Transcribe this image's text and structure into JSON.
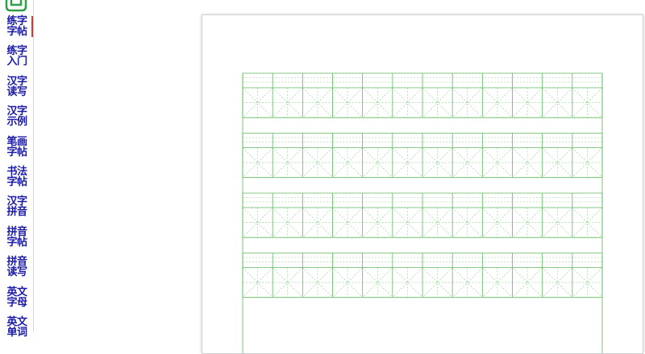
{
  "sidebar": {
    "items": [
      {
        "line1": "练字",
        "line2": "字帖",
        "active": true
      },
      {
        "line1": "练字",
        "line2": "入门"
      },
      {
        "line1": "汉字",
        "line2": "读写"
      },
      {
        "line1": "汉字",
        "line2": "示例"
      },
      {
        "line1": "笔画",
        "line2": "字帖"
      },
      {
        "line1": "书法",
        "line2": "字帖"
      },
      {
        "line1": "汉字",
        "line2": "拼音"
      },
      {
        "line1": "拼音",
        "line2": "字帖"
      },
      {
        "line1": "拼音",
        "line2": "读写"
      },
      {
        "line1": "英文",
        "line2": "字母"
      },
      {
        "line1": "英文",
        "line2": "单词"
      }
    ]
  },
  "worksheet": {
    "rows": 4,
    "cells_per_row": 12,
    "line_color": "#5cb85c",
    "guide_color": "#8ecf8e"
  },
  "colors": {
    "nav_text": "#1a1aa6",
    "accent": "#c83c3c"
  },
  "icons": {
    "logo": "green-logo-icon"
  }
}
